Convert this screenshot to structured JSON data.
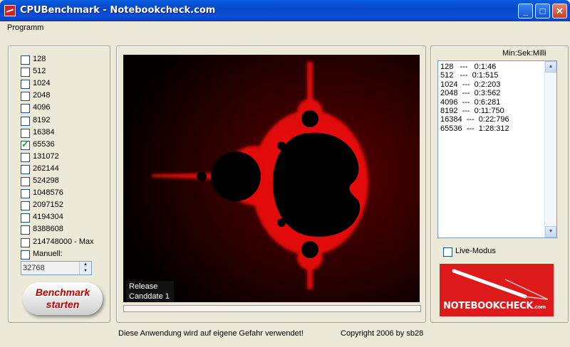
{
  "window": {
    "title": "CPUBenchmark - Notebookcheck.com"
  },
  "menu": {
    "items": [
      "Programm"
    ]
  },
  "iterations": [
    {
      "label": "128",
      "checked": false
    },
    {
      "label": "512",
      "checked": false
    },
    {
      "label": "1024",
      "checked": false
    },
    {
      "label": "2048",
      "checked": false
    },
    {
      "label": "4096",
      "checked": false
    },
    {
      "label": "8192",
      "checked": false
    },
    {
      "label": "16384",
      "checked": false
    },
    {
      "label": "65536",
      "checked": true
    },
    {
      "label": "131072",
      "checked": false
    },
    {
      "label": "262144",
      "checked": false
    },
    {
      "label": "524298",
      "checked": false
    },
    {
      "label": "1048576",
      "checked": false
    },
    {
      "label": "2097152",
      "checked": false
    },
    {
      "label": "4194304",
      "checked": false
    },
    {
      "label": "8388608",
      "checked": false
    },
    {
      "label": "214748000 - Max",
      "checked": false
    },
    {
      "label": "Manuell:",
      "checked": false
    }
  ],
  "manual": {
    "value": "32768"
  },
  "benchmark_button": {
    "line1": "Benchmark",
    "line2": "starten"
  },
  "release": {
    "line1": "Release",
    "line2": "Canddate 1"
  },
  "results": {
    "unit_label": "Min:Sek:Milli",
    "rows": [
      "128   ---   0:1:46",
      "512   ---  0:1:515",
      "1024  ---  0:2:203",
      "2048  ---  0:3:562",
      "4096  ---  0:6:281",
      "8192  ---  0:11:750",
      "16384  ---  0:22:796",
      "65536  ---  1:28:312"
    ]
  },
  "live_mode": {
    "label": "Live-Modus",
    "checked": false
  },
  "logo": {
    "text": "NOTEBOOKCHECK",
    "suffix": ".com"
  },
  "status": {
    "warning": "Diese Anwendung wird auf eigene Gefahr verwendet!",
    "copyright": "Copyright 2006 by sb28"
  },
  "colors": {
    "accent": "#dd1a1a",
    "fractal_edge": "#ff1a1a",
    "titlebar": "#0a50d8"
  }
}
